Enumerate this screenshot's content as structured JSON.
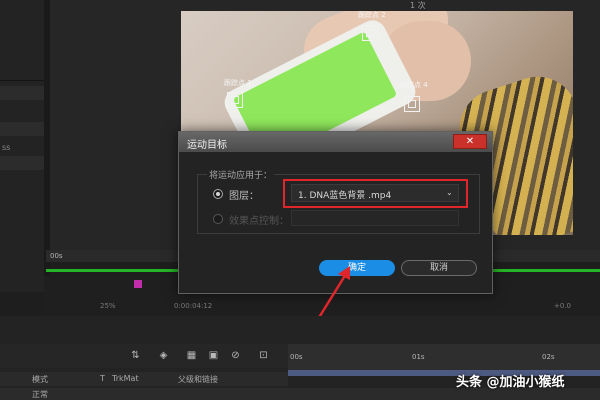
{
  "viewer": {
    "top_text": "1 次",
    "trackers": [
      {
        "label": "跟踪点 1"
      },
      {
        "label": "跟踪点 2"
      },
      {
        "label": "跟踪点 3"
      },
      {
        "label": "跟踪点 4"
      }
    ],
    "ruler_time": "00s",
    "controls": {
      "zoom": "25%",
      "timecode": "0:00:04:12",
      "exposure": "+0.0"
    }
  },
  "left_panel": {
    "label_1": "ss"
  },
  "dialog": {
    "title": "运动目标",
    "close_label": "✕",
    "group_label": "将运动应用于：",
    "option_layer": {
      "label": "图层：",
      "selected": true
    },
    "layer_select_value": "1. DNA蓝色背景 .mp4",
    "option_effect": {
      "label": "效果点控制：",
      "selected": false
    },
    "ok_label": "确定",
    "cancel_label": "取消"
  },
  "timeline": {
    "time_marks": [
      "00s",
      "01s",
      "02s"
    ],
    "headers": {
      "mode": "模式",
      "t": "T",
      "trkmat": "TrkMat",
      "parent": "父级和链接"
    },
    "row": {
      "mode_value": "正常"
    }
  },
  "watermark": "头条 @加油小猴纸",
  "colors": {
    "accent_blue": "#1b8de4",
    "highlight_red": "#e0262a",
    "green_screen": "#8fe85c",
    "timeline_green": "#25b425"
  }
}
